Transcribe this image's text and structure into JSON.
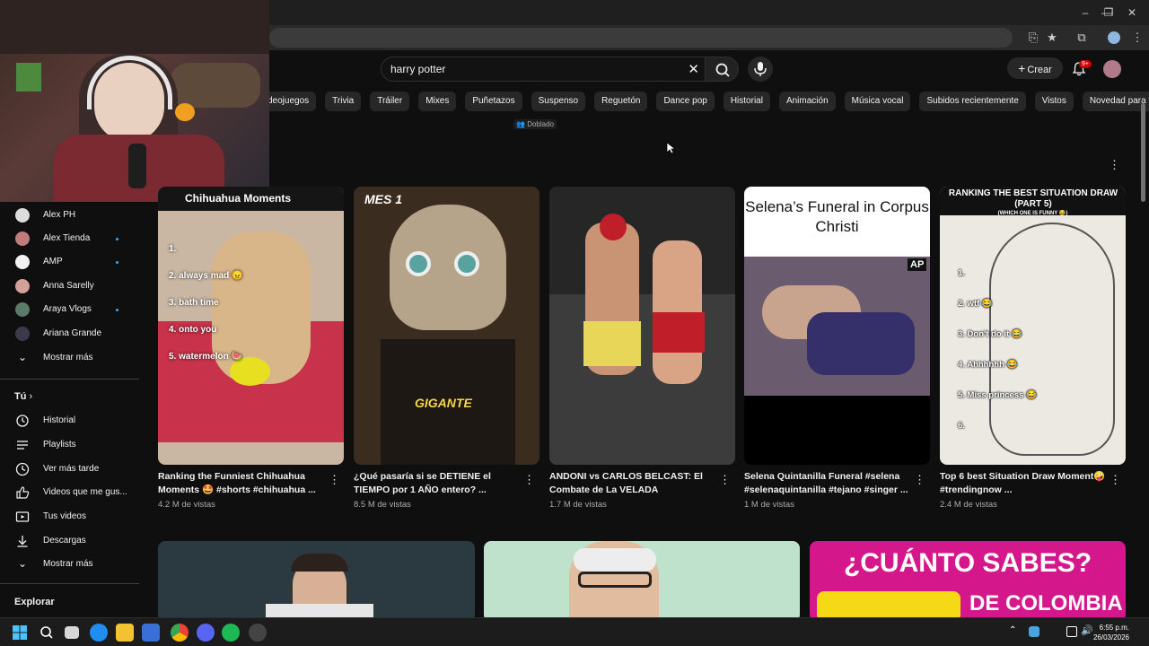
{
  "search": {
    "value": "harry potter",
    "clear_icon": "close-icon"
  },
  "header": {
    "create_label": "Crear",
    "notifications_badge": "9+"
  },
  "chips": [
    "deojuegos",
    "Trivia",
    "Tráiler",
    "Mixes",
    "Puñetazos",
    "Suspenso",
    "Reguetón",
    "Dance pop",
    "Historial",
    "Animación",
    "Música vocal",
    "Subidos recientemente",
    "Vistos",
    "Novedad para ti"
  ],
  "dubbed_badge": "Doblado",
  "sidebar": {
    "subscriptions": [
      {
        "label": "Alex PH",
        "dot": false
      },
      {
        "label": "Alex Tienda",
        "dot": true
      },
      {
        "label": "AMP",
        "dot": true
      },
      {
        "label": "Anna Sarelly",
        "dot": false
      },
      {
        "label": "Araya Vlogs",
        "dot": true
      },
      {
        "label": "Ariana Grande",
        "dot": false
      }
    ],
    "show_more_1": "Mostrar más",
    "you_heading": "Tú",
    "you_items": [
      "Historial",
      "Playlists",
      "Ver más tarde",
      "Videos que me gus...",
      "Tus videos",
      "Descargas"
    ],
    "show_more_2": "Mostrar más",
    "explore_heading": "Explorar"
  },
  "videos": [
    {
      "title": "Ranking the Funniest Chihuahua Moments 🤩 #shorts #chihuahua ...",
      "views": "4.2 M de vistas",
      "thumb_caption": "Chihuahua Moments",
      "thumb_list": [
        "1.",
        "2. always mad 😠",
        "3. bath time",
        "4. onto you",
        "5. watermelon 🍉"
      ]
    },
    {
      "title": "¿Qué pasaría si se DETIENE el TIEMPO por 1 AÑO entero? ...",
      "views": "8.5 M de vistas",
      "thumb_top": "MES 1",
      "thumb_bottom": "GIGANTE"
    },
    {
      "title": "ANDONI vs CARLOS BELCAST: El Combate de La VELADA",
      "views": "1.7 M de vistas"
    },
    {
      "title": "Selena Quintanilla Funeral #selena #selenaquintanilla #tejano #singer ...",
      "views": "1 M de vistas",
      "thumb_caption": "Selena’s Funeral in Corpus Christi",
      "thumb_badge": "AP"
    },
    {
      "title": "Top 6 best Situation Draw Moment🤪 #trendingnow ...",
      "views": "2.4 M de vistas",
      "thumb_caption": "RANKING THE BEST SITUATION DRAW (PART 5)",
      "thumb_sub": "(WHICH ONE IS FUNNY 😂)",
      "thumb_list": [
        "1.",
        "2. wtf 😂",
        "3. Don't do it 😂",
        "4. Ahhhhhh 😂",
        "5. Miss princess 😂",
        "6."
      ]
    }
  ],
  "bottom_thumb": {
    "line1": "¿CUÁNTO SABES?",
    "line2": "DE COLOMBIA"
  },
  "taskbar": {
    "time": "6:55 p.m.",
    "date": "26/03/2026"
  },
  "colors": {
    "background": "#0f0f0f",
    "chip": "#272727",
    "accent_red": "#cc0000",
    "link_dot": "#3ea6ff"
  }
}
